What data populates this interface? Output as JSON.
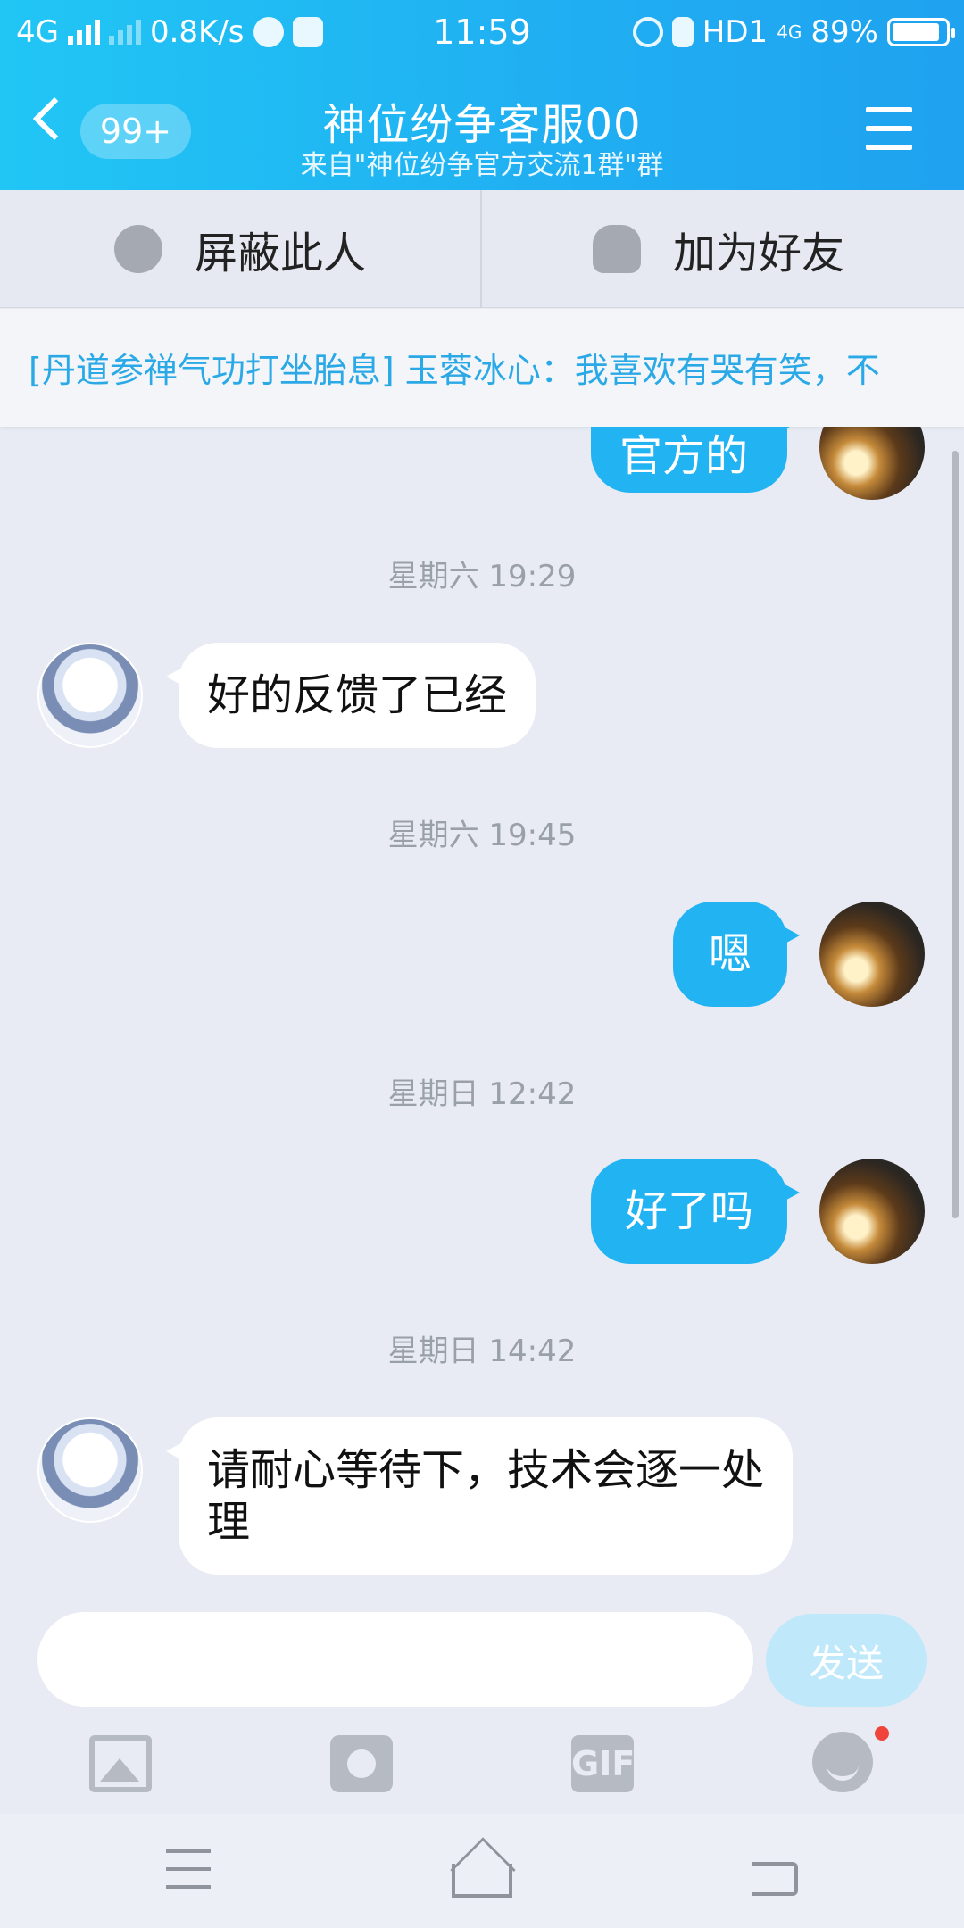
{
  "status_bar": {
    "network": "4G",
    "speed": "0.8K/s",
    "time": "11:59",
    "hd": "HD1",
    "network2": "4G",
    "battery": "89%",
    "battery_level": 0.89
  },
  "header": {
    "back_badge": "99+",
    "title": "神位纷争客服00",
    "subtitle": "来自\"神位纷争官方交流1群\"群",
    "icons": [
      "back-arrow-icon",
      "hamburger-menu-icon"
    ]
  },
  "actions": {
    "block_label": "屏蔽此人",
    "add_friend_label": "加为好友"
  },
  "notice": {
    "text": "[丹道参禅气功打坐胎息] 玉蓉冰心：我喜欢有哭有笑，不"
  },
  "messages": [
    {
      "type": "out",
      "text": "官方的"
    },
    {
      "type": "time",
      "text": "星期六 19:29"
    },
    {
      "type": "in",
      "text": "好的反馈了已经"
    },
    {
      "type": "time",
      "text": "星期六 19:45"
    },
    {
      "type": "out",
      "text": "嗯"
    },
    {
      "type": "time",
      "text": "星期日 12:42"
    },
    {
      "type": "out",
      "text": "好了吗"
    },
    {
      "type": "time",
      "text": "星期日 14:42"
    },
    {
      "type": "in",
      "text": "请耐心等待下，技术会逐一处理"
    }
  ],
  "composer": {
    "input_value": "",
    "send_label": "发送"
  },
  "toolbar": {
    "gif_label": "GIF",
    "icons": [
      "image-icon",
      "camera-icon",
      "gif-icon",
      "emoji-icon"
    ]
  },
  "colors": {
    "accent": "#22b3f3",
    "header_gradient_start": "#21c6f5",
    "header_gradient_end": "#1fa2f0",
    "background": "#e8ebf3",
    "send_disabled": "#bfe9fb",
    "notification_dot": "#f0443a"
  }
}
